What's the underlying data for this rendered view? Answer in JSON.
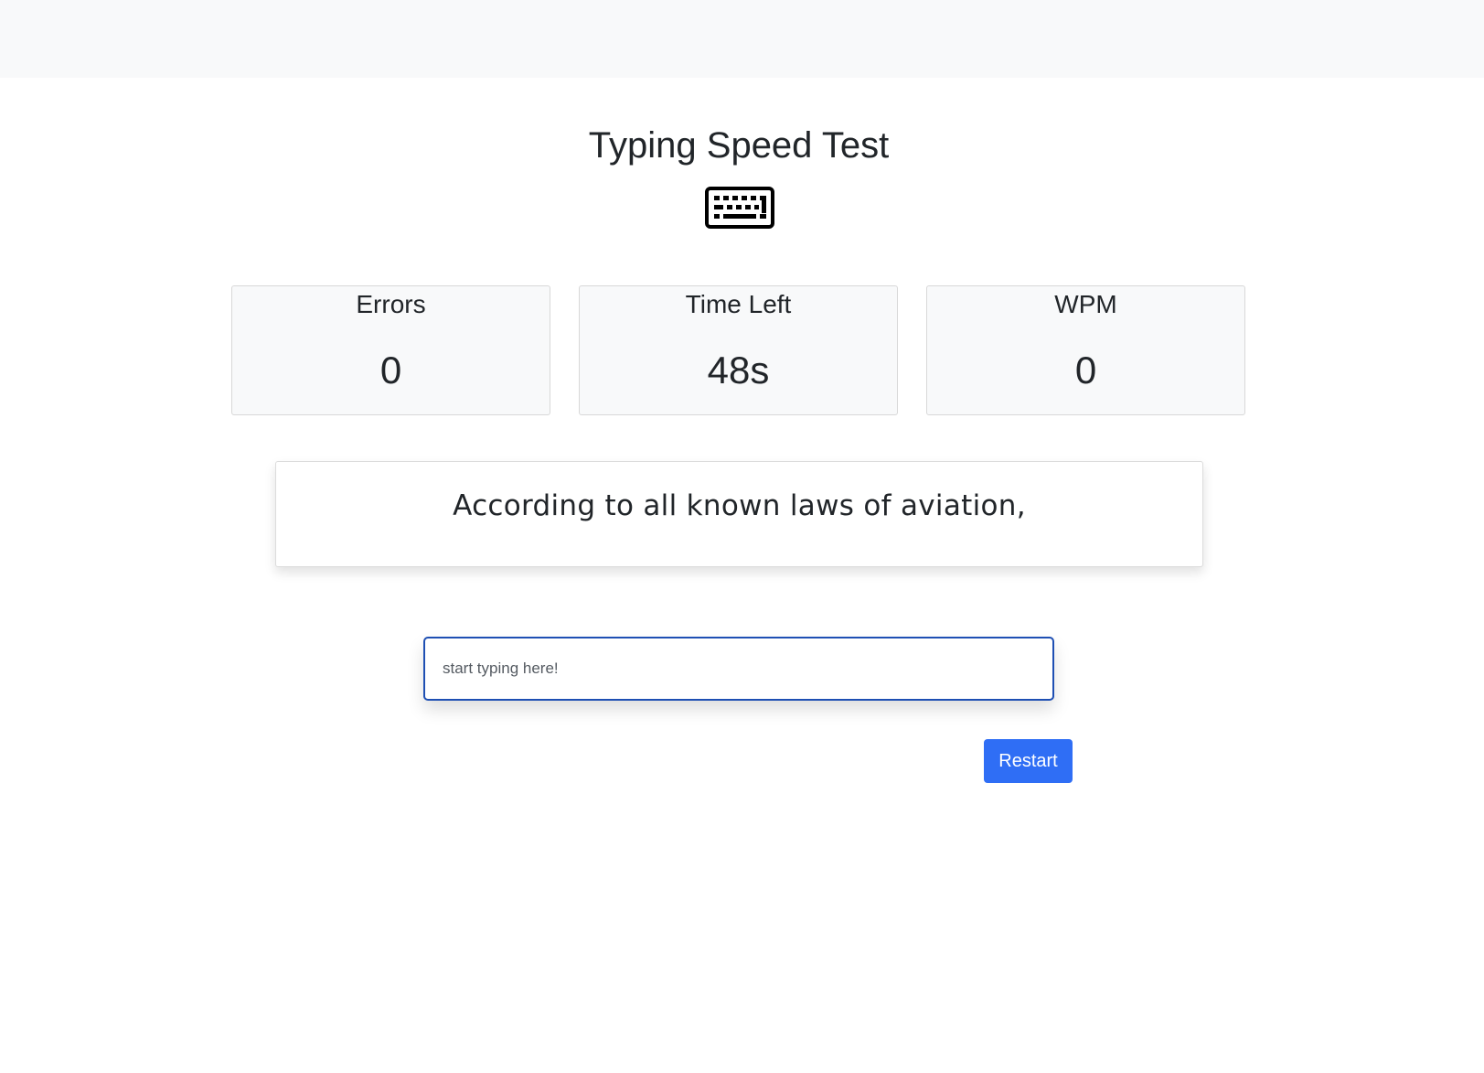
{
  "header": {
    "title": "Typing Speed Test",
    "icon": "keyboard-icon"
  },
  "stats": {
    "errors": {
      "label": "Errors",
      "value": "0"
    },
    "time_left": {
      "label": "Time Left",
      "value": "48s"
    },
    "wpm": {
      "label": "WPM",
      "value": "0"
    }
  },
  "quote": {
    "text": "According to all known laws of aviation,"
  },
  "input": {
    "value": "",
    "placeholder": "start typing here!"
  },
  "actions": {
    "restart_label": "Restart"
  },
  "colors": {
    "topbar": "#f8f9fa",
    "card_background": "#f8f9fa",
    "input_focus_border": "#1e4fb3",
    "primary_button": "#2f6ef5"
  }
}
